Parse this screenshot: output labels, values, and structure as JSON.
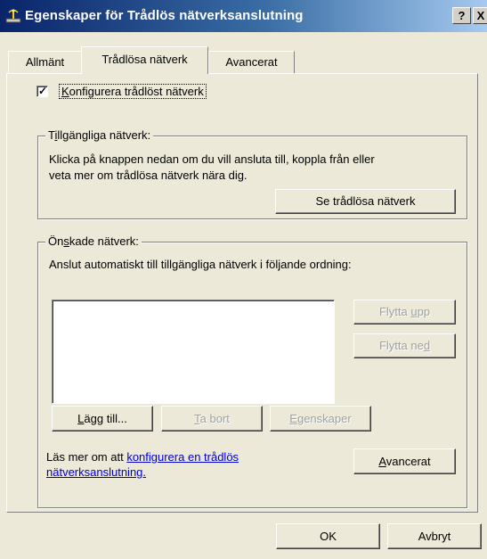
{
  "window": {
    "title": "Egenskaper för Trådlös nätverksanslutning",
    "help_label": "?",
    "close_label": "X"
  },
  "tabs": [
    {
      "label": "Allmänt",
      "active": false
    },
    {
      "label": "Trådlösa nätverk",
      "active": true
    },
    {
      "label": "Avancerat",
      "active": false
    }
  ],
  "configure": {
    "checked": true,
    "label_pre": "",
    "label_hot": "K",
    "label_post": "onfigurera trådlöst nätverk"
  },
  "available": {
    "legend_pre": "T",
    "legend_hot": "i",
    "legend_post": "llgängliga nätverk:",
    "line1": "Klicka på knappen nedan om du vill ansluta till, koppla från eller",
    "line2": "veta mer om trådlösa nätverk nära dig.",
    "view_button": "Se trådlösa nätverk"
  },
  "preferred": {
    "legend_pre": "Ön",
    "legend_hot": "s",
    "legend_post": "kade nätverk:",
    "description": "Anslut automatiskt till tillgängliga nätverk i följande ordning:",
    "move_up_pre": "Flytta ",
    "move_up_hot": "u",
    "move_up_post": "pp",
    "move_down_pre": "Flytta ne",
    "move_down_hot": "d",
    "move_down_post": "",
    "add_pre": "",
    "add_hot": "L",
    "add_post": "ägg till...",
    "remove_pre": "",
    "remove_hot": "T",
    "remove_post": "a bort",
    "props_pre": "",
    "props_hot": "E",
    "props_post": "genskaper",
    "learn_text": "Läs mer om att ",
    "learn_link1": "konfigurera en trådlös",
    "learn_link2": "nätverksanslutning.",
    "advanced_pre": "",
    "advanced_hot": "A",
    "advanced_post": "vancerat"
  },
  "footer": {
    "ok": "OK",
    "cancel": "Avbryt"
  },
  "colors": {
    "face": "#ece9d8",
    "titlebar_start": "#0a246a",
    "link": "#0000cc"
  }
}
